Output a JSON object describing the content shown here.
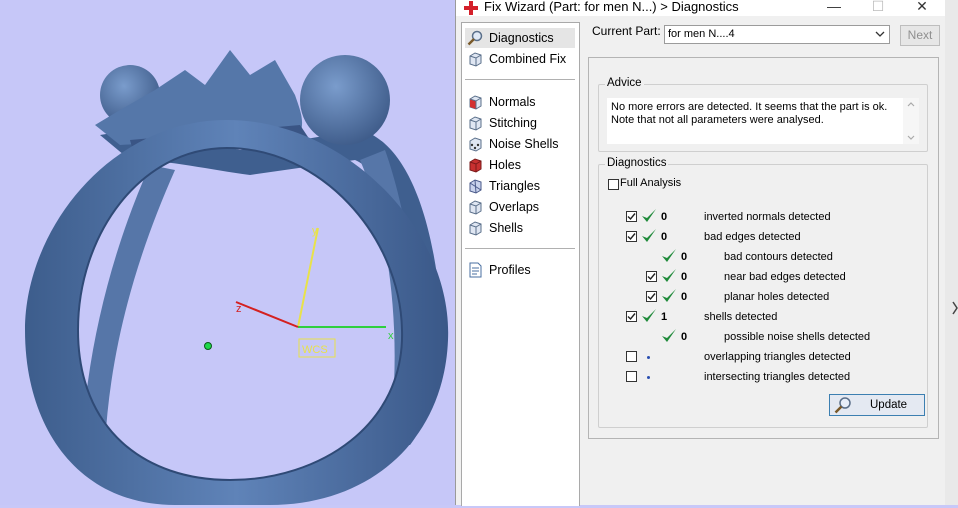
{
  "window": {
    "title": "Fix Wizard (Part: for men N...) > Diagnostics",
    "minimize_glyph": "—",
    "maximize_glyph": "☐",
    "close_glyph": "✕"
  },
  "viewport": {
    "axis_labels": {
      "x": "x",
      "y": "y",
      "z": "z"
    },
    "wcs_label": "WCS"
  },
  "sidebar": {
    "items": [
      {
        "label": "Diagnostics",
        "icon": "magnifier-icon",
        "selected": true
      },
      {
        "label": "Combined Fix",
        "icon": "cube-icon"
      },
      {
        "label": "Normals",
        "icon": "cube-red-face-icon"
      },
      {
        "label": "Stitching",
        "icon": "cube-icon"
      },
      {
        "label": "Noise Shells",
        "icon": "cube-dots-icon"
      },
      {
        "label": "Holes",
        "icon": "cube-red-icon"
      },
      {
        "label": "Triangles",
        "icon": "cube-icon"
      },
      {
        "label": "Overlaps",
        "icon": "cube-icon"
      },
      {
        "label": "Shells",
        "icon": "cube-icon"
      },
      {
        "label": "Profiles",
        "icon": "document-icon"
      }
    ]
  },
  "current_part": {
    "label": "Current Part:",
    "value": "for men N....4",
    "next_label": "Next"
  },
  "advice": {
    "title": "Advice",
    "text": "No more errors are detected. It seems that the part is ok. Note that not all parameters were analysed."
  },
  "diagnostics": {
    "title": "Diagnostics",
    "full_analysis_label": "Full Analysis",
    "full_analysis_checked": false,
    "rows": [
      {
        "checkbox": true,
        "checked": true,
        "status": "ok",
        "count": "0",
        "label": "inverted normals detected",
        "level": 0
      },
      {
        "checkbox": true,
        "checked": true,
        "status": "ok",
        "count": "0",
        "label": "bad edges detected",
        "level": 0
      },
      {
        "checkbox": false,
        "checked": false,
        "status": "ok",
        "count": "0",
        "label": "bad contours detected",
        "level": 1
      },
      {
        "checkbox": true,
        "checked": true,
        "status": "ok",
        "count": "0",
        "label": "near bad edges detected",
        "level": 1
      },
      {
        "checkbox": true,
        "checked": true,
        "status": "ok",
        "count": "0",
        "label": "planar holes detected",
        "level": 1
      },
      {
        "checkbox": true,
        "checked": true,
        "status": "ok",
        "count": "1",
        "label": "shells detected",
        "level": 0
      },
      {
        "checkbox": false,
        "checked": false,
        "status": "ok",
        "count": "0",
        "label": "possible noise shells detected",
        "level": 1
      },
      {
        "checkbox": true,
        "checked": false,
        "status": "pending",
        "count": "",
        "label": "overlapping triangles detected",
        "level": 0
      },
      {
        "checkbox": true,
        "checked": false,
        "status": "pending",
        "count": "",
        "label": "intersecting triangles detected",
        "level": 0
      }
    ],
    "update_label": "Update"
  },
  "colors": {
    "viewport_bg": "#c6c7f8",
    "model_blue": "#4e6f9e",
    "tick_green": "#1f8a3a",
    "title_icon_red": "#d4202a"
  }
}
